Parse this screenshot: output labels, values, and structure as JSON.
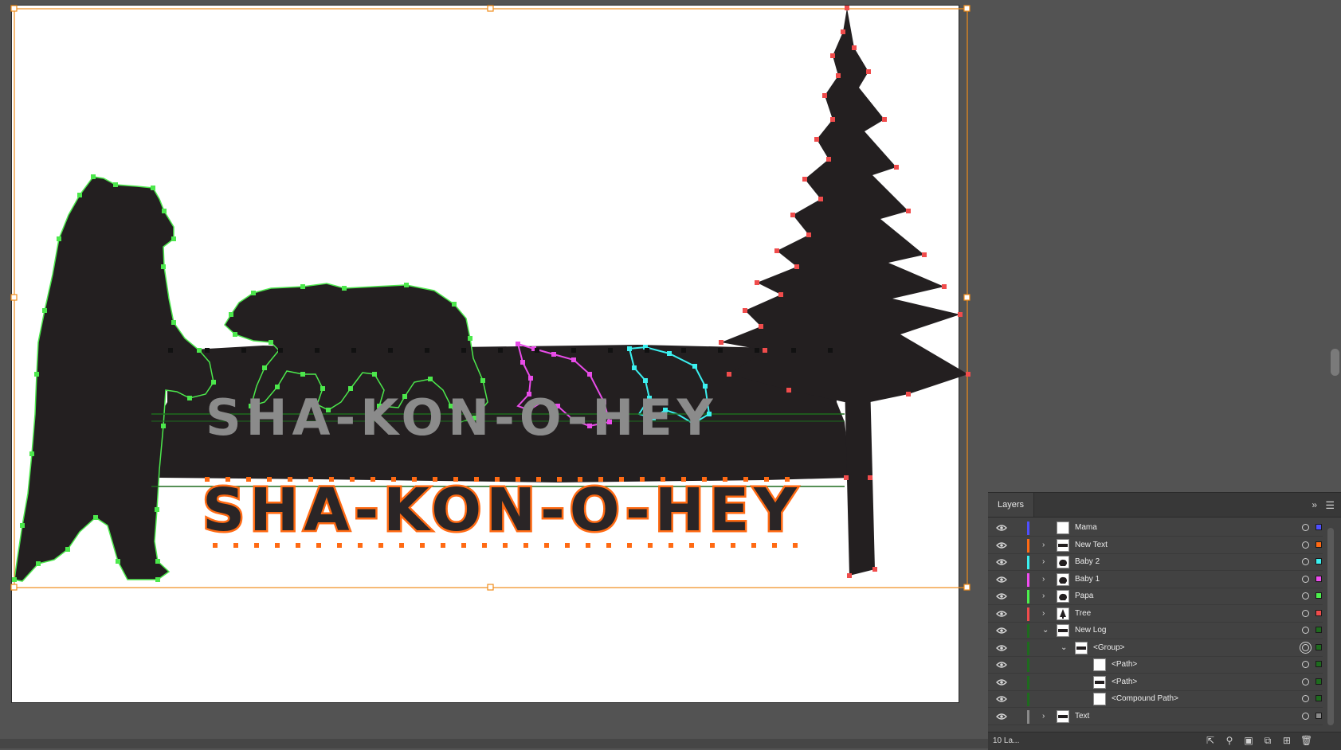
{
  "artwork": {
    "sign_text_gray": "SHA-KON-O-HEY",
    "sign_text_orange": "SHA-KON-O-HEY"
  },
  "layers_panel": {
    "tab_label": "Layers",
    "collapse_icon": "double-chevron-right-icon",
    "menu_icon": "hamburger-menu-icon",
    "layer_count": "10 La...",
    "rows": [
      {
        "name": "Mama",
        "color": "#4f4fff",
        "thumb": "blank",
        "twirl": "",
        "indent": 0
      },
      {
        "name": "New Text",
        "color": "#ff6a13",
        "thumb": "text",
        "twirl": "collapsed",
        "indent": 0
      },
      {
        "name": "Baby 2",
        "color": "#3bf0f0",
        "thumb": "bear",
        "twirl": "collapsed",
        "indent": 0
      },
      {
        "name": "Baby 1",
        "color": "#f04cf0",
        "thumb": "bear",
        "twirl": "collapsed",
        "indent": 0
      },
      {
        "name": "Papa",
        "color": "#4cf04c",
        "thumb": "bear",
        "twirl": "collapsed",
        "indent": 0
      },
      {
        "name": "Tree",
        "color": "#f04c4c",
        "thumb": "tree",
        "twirl": "collapsed",
        "indent": 0
      },
      {
        "name": "New Log",
        "color": "#1e6b1e",
        "thumb": "log",
        "twirl": "expanded",
        "indent": 0
      },
      {
        "name": "<Group>",
        "color": "#1e6b1e",
        "thumb": "log",
        "twirl": "expanded",
        "indent": 1
      },
      {
        "name": "<Path>",
        "color": "#1e6b1e",
        "thumb": "blank",
        "twirl": "",
        "indent": 2
      },
      {
        "name": "<Path>",
        "color": "#1e6b1e",
        "thumb": "log",
        "twirl": "",
        "indent": 2
      },
      {
        "name": "<Compound Path>",
        "color": "#1e6b1e",
        "thumb": "blank",
        "twirl": "",
        "indent": 2
      },
      {
        "name": "Text",
        "color": "#8a8a8a",
        "thumb": "text",
        "twirl": "collapsed",
        "indent": 0
      }
    ],
    "footer_icons": [
      "export-icon",
      "search-icon",
      "clipping-mask-icon",
      "new-sublayer-icon",
      "new-layer-icon",
      "trash-icon"
    ]
  }
}
